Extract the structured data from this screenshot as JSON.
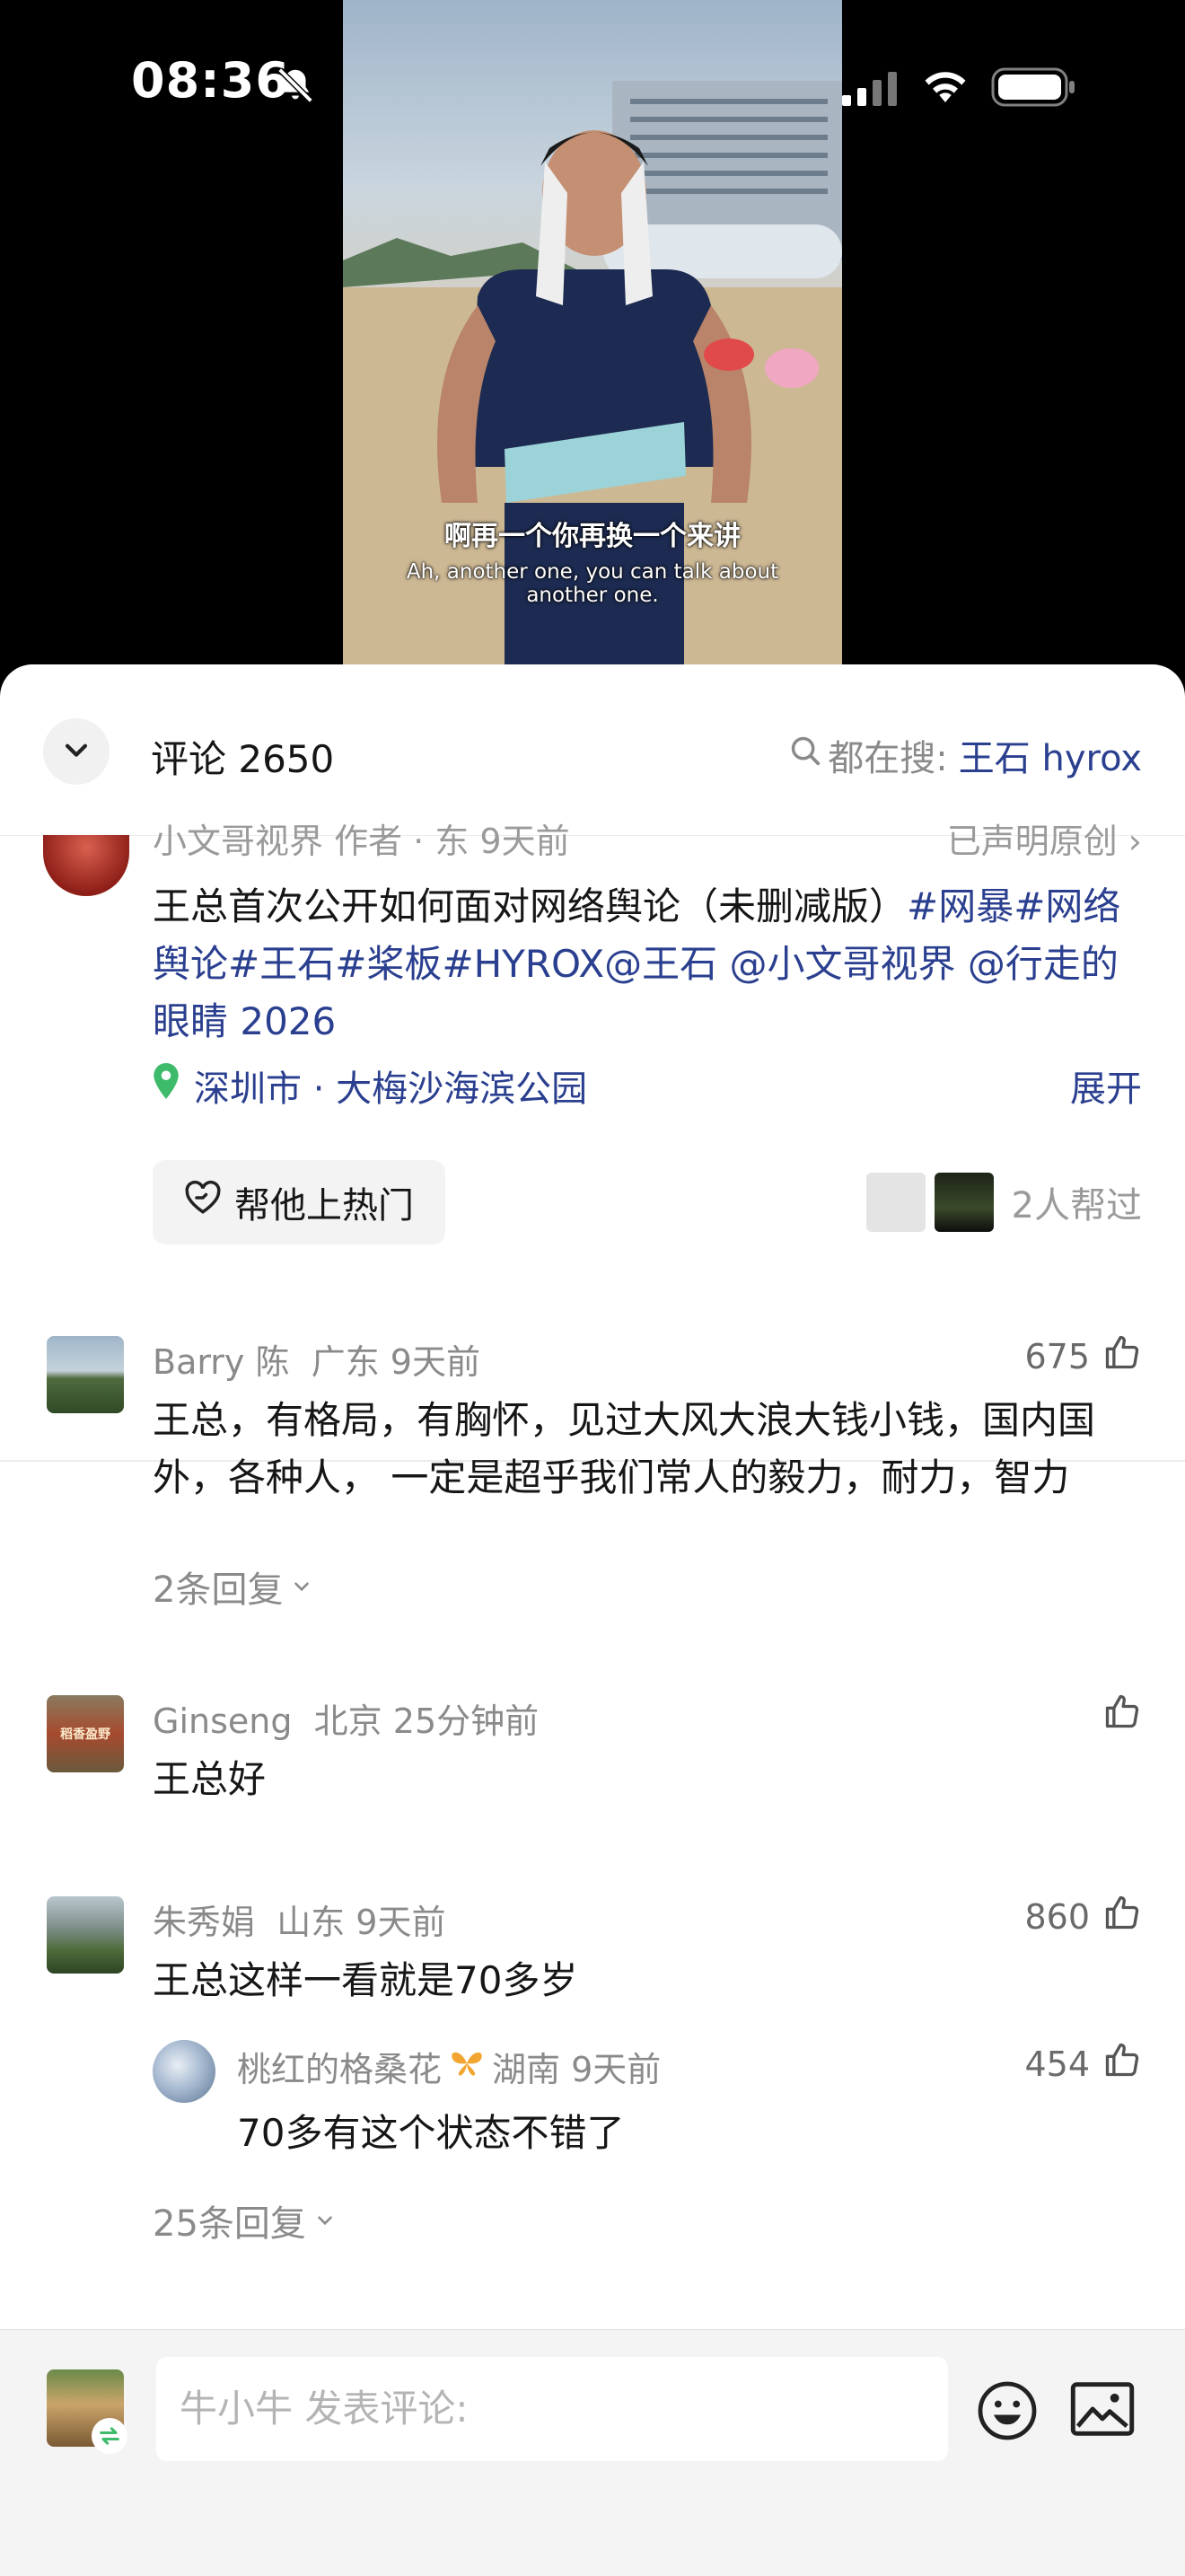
{
  "status_bar": {
    "time": "08:36"
  },
  "video": {
    "subtitle_cn": "啊再一个你再换一个来讲",
    "subtitle_en": "Ah, another one, you can talk about another one."
  },
  "header": {
    "title": "评论 2650",
    "search_label": "都在搜:",
    "search_keyword": "王石 hyrox"
  },
  "post": {
    "author_meta": "小文哥视界  作者 · 东 9天前",
    "original_label": "已声明原创 ›",
    "text_plain": "王总首次公开如何面对网络舆论（未删减版）",
    "tags": "#网暴#网络舆论#王石#桨板#HYROX@王石 @小文哥视界 @行走的眼睛 2026",
    "location": "深圳市 · 大梅沙海滨公园",
    "expand": "展开",
    "boost_label": "帮他上热门",
    "helpers_text": "2人帮过"
  },
  "comments": [
    {
      "name": "Barry 陈",
      "region": "广东",
      "time": "9天前",
      "likes": "675",
      "text": "王总，有格局，有胸怀，见过大风大浪大钱小钱，国内国外，各种人， 一定是超乎我们常人的毅力，耐力，智力",
      "replies_label": "2条回复"
    },
    {
      "name": "Ginseng",
      "region": "北京",
      "time": "25分钟前",
      "likes": "",
      "text": "王总好",
      "avatar_text": "稻香盈野"
    },
    {
      "name": "朱秀娟",
      "region": "山东",
      "time": "9天前",
      "likes": "860",
      "text": "王总这样一看就是70多岁",
      "reply": {
        "name": "桃红的格桑花",
        "region": "湖南",
        "time": "9天前",
        "likes": "454",
        "text": "70多有这个状态不错了"
      },
      "replies_label": "25条回复"
    }
  ],
  "composer": {
    "placeholder": "牛小牛 发表评论:"
  },
  "colors": {
    "link": "#2a3f8f",
    "location_green": "#3dbb6b",
    "author_badge_green": "#2fb55c",
    "muted": "#8a8a8a"
  }
}
